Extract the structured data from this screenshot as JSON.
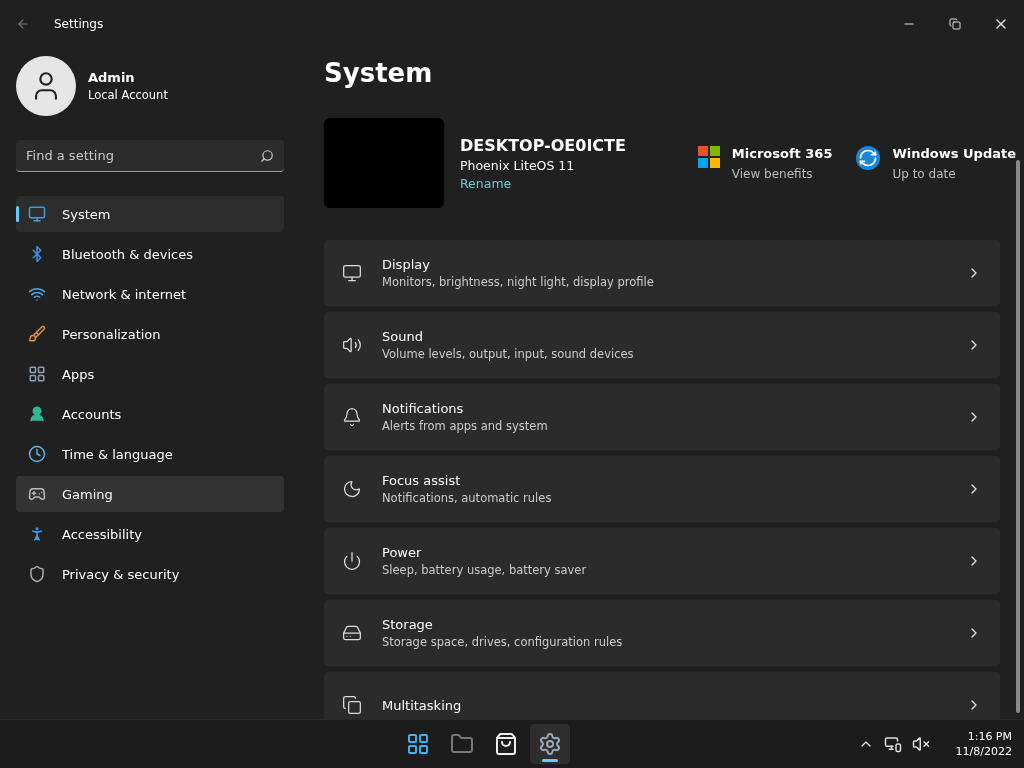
{
  "window": {
    "title": "Settings"
  },
  "account": {
    "name": "Admin",
    "type": "Local Account"
  },
  "search": {
    "placeholder": "Find a setting"
  },
  "sidebar": {
    "items": [
      {
        "label": "System",
        "selected": true,
        "hovered": false
      },
      {
        "label": "Bluetooth & devices",
        "selected": false,
        "hovered": false
      },
      {
        "label": "Network & internet",
        "selected": false,
        "hovered": false
      },
      {
        "label": "Personalization",
        "selected": false,
        "hovered": false
      },
      {
        "label": "Apps",
        "selected": false,
        "hovered": false
      },
      {
        "label": "Accounts",
        "selected": false,
        "hovered": false
      },
      {
        "label": "Time & language",
        "selected": false,
        "hovered": false
      },
      {
        "label": "Gaming",
        "selected": false,
        "hovered": true
      },
      {
        "label": "Accessibility",
        "selected": false,
        "hovered": false
      },
      {
        "label": "Privacy & security",
        "selected": false,
        "hovered": false
      }
    ]
  },
  "page": {
    "title": "System"
  },
  "device": {
    "name": "DESKTOP-OE0ICTE",
    "os": "Phoenix LiteOS 11",
    "link": "Rename"
  },
  "promos": [
    {
      "title": "Microsoft 365",
      "subtitle": "View benefits"
    },
    {
      "title": "Windows Update",
      "subtitle": "Up to date"
    }
  ],
  "settings": [
    {
      "title": "Display",
      "subtitle": "Monitors, brightness, night light, display profile"
    },
    {
      "title": "Sound",
      "subtitle": "Volume levels, output, input, sound devices"
    },
    {
      "title": "Notifications",
      "subtitle": "Alerts from apps and system"
    },
    {
      "title": "Focus assist",
      "subtitle": "Notifications, automatic rules"
    },
    {
      "title": "Power",
      "subtitle": "Sleep, battery usage, battery saver"
    },
    {
      "title": "Storage",
      "subtitle": "Storage space, drives, configuration rules"
    },
    {
      "title": "Multitasking"
    }
  ],
  "taskbar": {
    "apps": [
      {
        "active": false
      },
      {
        "active": false
      },
      {
        "active": false
      },
      {
        "active": true
      }
    ],
    "time": "1:16 PM",
    "date": "11/8/2022"
  }
}
